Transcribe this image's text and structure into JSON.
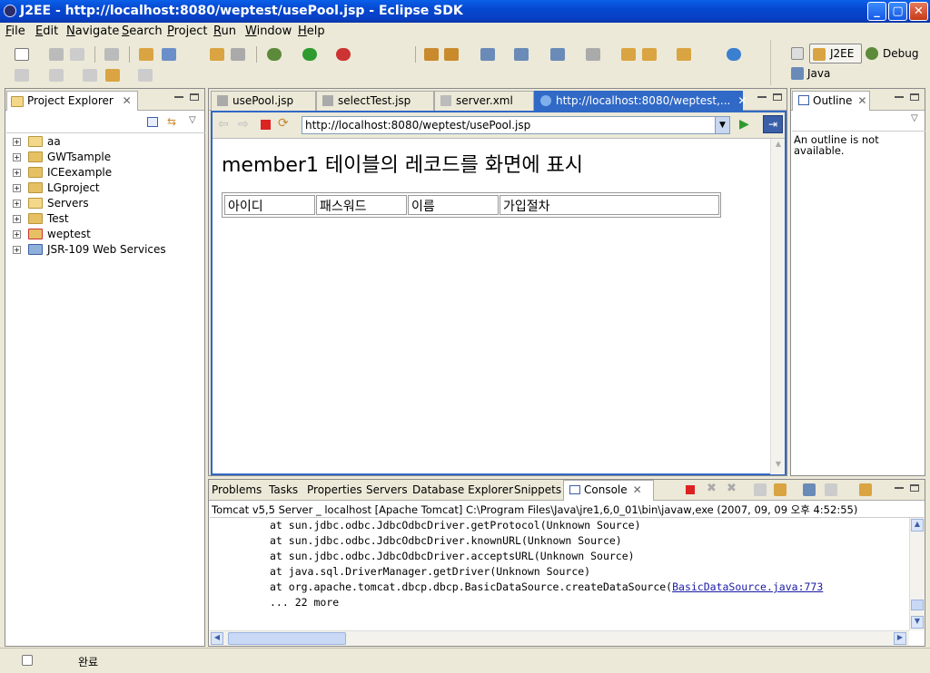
{
  "window": {
    "title": "J2EE - http://localhost:8080/weptest/usePool.jsp - Eclipse SDK",
    "min": "_",
    "max": "▢",
    "close": "✕"
  },
  "menu": [
    "File",
    "Edit",
    "Navigate",
    "Search",
    "Project",
    "Run",
    "Window",
    "Help"
  ],
  "perspectives": {
    "j2ee": "J2EE",
    "debug": "Debug",
    "java": "Java"
  },
  "project_explorer": {
    "title": "Project Explorer",
    "items": [
      "aa",
      "GWTsample",
      "ICEexample",
      "LGproject",
      "Servers",
      "Test",
      "weptest",
      "JSR-109 Web Services"
    ]
  },
  "editor_tabs": [
    "usePool.jsp",
    "selectTest.jsp",
    "server.xml",
    "http://localhost:8080/weptest,..."
  ],
  "browser": {
    "url": "http://localhost:8080/weptest/usePool.jsp",
    "heading": "member1 테이블의 레코드를 화면에 표시",
    "columns": [
      "아이디",
      "패스워드",
      "이름",
      "가입절차"
    ]
  },
  "outline": {
    "title": "Outline",
    "message_line1": "An outline is not",
    "message_line2": "available."
  },
  "bottom_tabs": [
    "Problems",
    "Tasks",
    "Properties",
    "Servers",
    "Database Explorer",
    "Snippets",
    "Console"
  ],
  "console": {
    "header": "Tomcat v5,5 Server _ localhost [Apache Tomcat] C:\\Program Files\\Java\\jre1,6,0_01\\bin\\javaw,exe (2007, 09, 09 오후 4:52:55)",
    "lines": [
      "at sun.jdbc.odbc.JdbcOdbcDriver.getProtocol(Unknown Source)",
      "at sun.jdbc.odbc.JdbcOdbcDriver.knownURL(Unknown Source)",
      "at sun.jdbc.odbc.JdbcOdbcDriver.acceptsURL(Unknown Source)",
      "at java.sql.DriverManager.getDriver(Unknown Source)",
      "at org.apache.tomcat.dbcp.dbcp.BasicDataSource.createDataSource(",
      "... 22 more"
    ],
    "link": "BasicDataSource.java:773"
  },
  "status": {
    "text": "완료"
  },
  "colors": {
    "titlebar": "#0648d0",
    "chrome": "#ece9d8",
    "active_tab": "#3169c6"
  }
}
